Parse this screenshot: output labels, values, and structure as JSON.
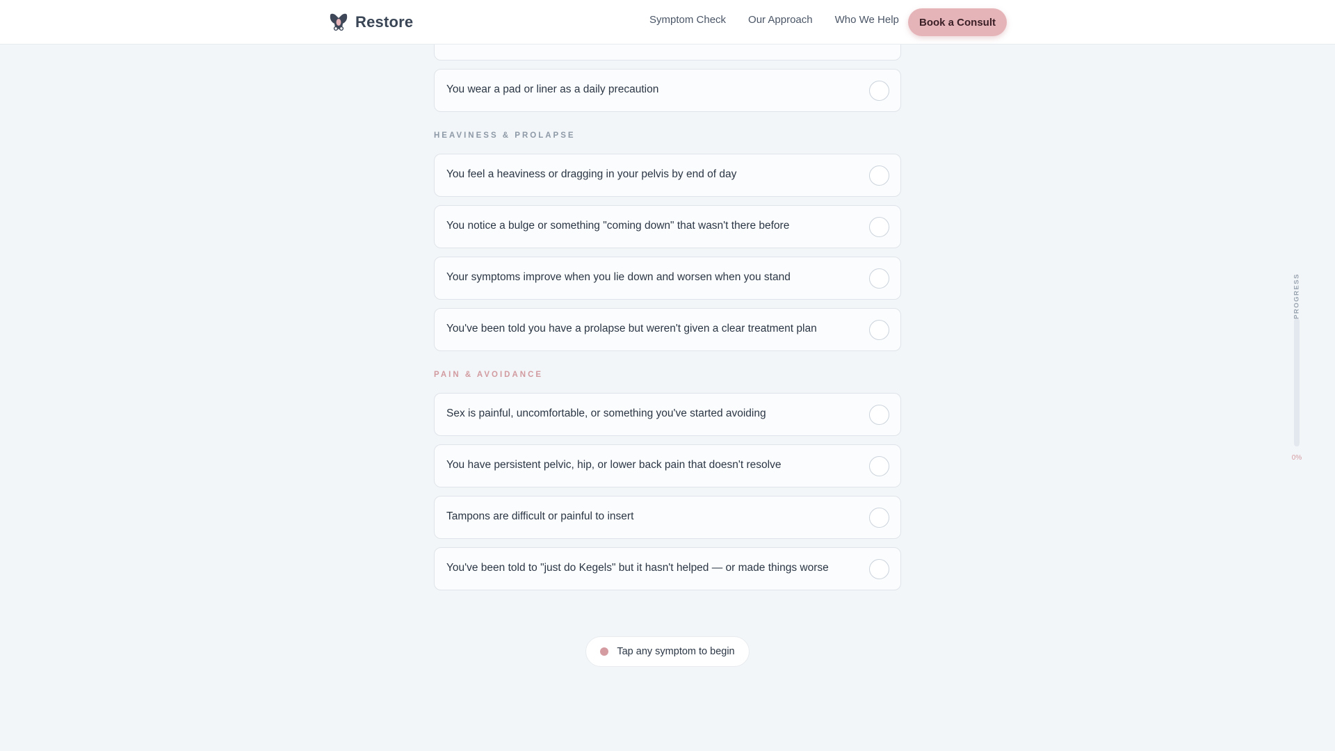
{
  "header": {
    "brand_name": "Restore",
    "logo_icon": "pelvis-logo-icon",
    "nav": [
      {
        "label": "Symptom Check"
      },
      {
        "label": "Our Approach"
      },
      {
        "label": "Who We Help"
      }
    ],
    "cta_label": "Book a Consult"
  },
  "symptoms": {
    "top_partial": "",
    "top_item": "You wear a pad or liner as a daily precaution",
    "sections": [
      {
        "title": "HEAVINESS & PROLAPSE",
        "items": [
          "You feel a heaviness or dragging in your pelvis by end of day",
          "You notice a bulge or something \"coming down\" that wasn't there before",
          "Your symptoms improve when you lie down and worsen when you stand",
          "You've been told you have a prolapse but weren't given a clear treatment plan"
        ]
      },
      {
        "title": "PAIN & AVOIDANCE",
        "items": [
          "Sex is painful, uncomfortable, or something you've started avoiding",
          "You have persistent pelvic, hip, or lower back pain that doesn't resolve",
          "Tampons are difficult or painful to insert",
          "You've been told to \"just do Kegels\" but it hasn't helped — or made things worse"
        ]
      }
    ]
  },
  "status": {
    "text": "Tap any symptom to begin"
  },
  "progress": {
    "label": "PROGRESS",
    "value_percent": 0,
    "percent_text": "0%"
  },
  "colors": {
    "accent": "#d49ba1",
    "cta_bg": "#e5b4b8",
    "background": "#f3f6f9",
    "section_slate": "#8d99a6",
    "section_rose": "#d19ba0"
  }
}
